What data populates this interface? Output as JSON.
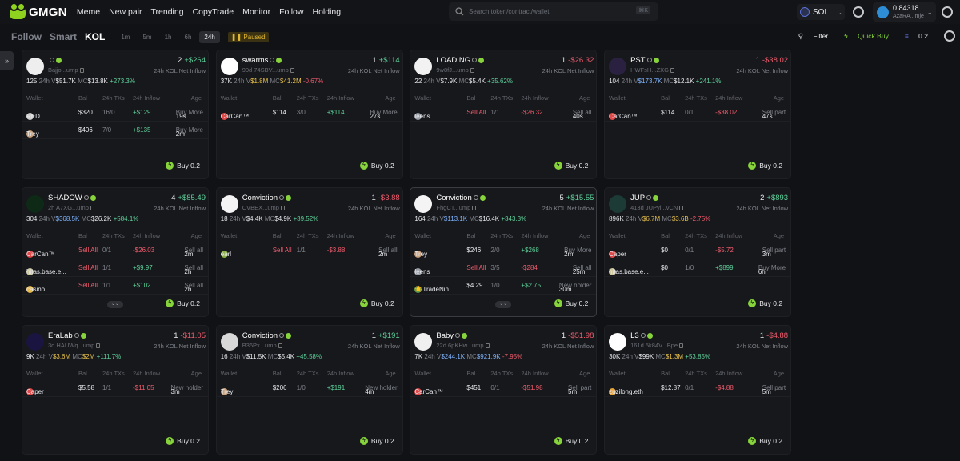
{
  "topbar": {
    "brand": "GMGN",
    "nav": [
      "Meme",
      "New pair",
      "Trending",
      "CopyTrade",
      "Monitor",
      "Follow",
      "Holding"
    ],
    "search_placeholder": "Search token/contract/wallet",
    "search_kbd": "⌘K",
    "chain": "SOL",
    "balance": "0.84318",
    "account": "AzaRA...mje"
  },
  "subbar": {
    "tabs": [
      "Follow",
      "Smart",
      "KOL"
    ],
    "timeframes": [
      "1m",
      "5m",
      "1h",
      "6h",
      "24h"
    ],
    "paused": "Paused",
    "filter": "Filter",
    "quick_buy": "Quick Buy",
    "quick_amount": "0.2"
  },
  "cols": [
    "Wallet",
    "Bal",
    "24h TXs",
    "24h Inflow",
    "Age"
  ],
  "buy_label": "Buy 0.2",
  "net_label": "24h KOL Net Inflow",
  "cards": [
    {
      "name": "",
      "addr": "Bajjo...ump",
      "kol": "2",
      "flow": "+$264",
      "holders": "125",
      "vol": "$51.7K",
      "mc": "$13.8K",
      "chg": "+273.3%",
      "chgc": "g",
      "volc": "w",
      "mcc": "w",
      "avatar": "#eeeeee",
      "rows": [
        {
          "w": "RED",
          "bal": "$320",
          "tx": "16/0",
          "in": "+$129",
          "age": "19s",
          "act": "Buy More",
          "txc": "gy",
          "ic": "#d0d0d0"
        },
        {
          "w": "Trey",
          "bal": "$406",
          "tx": "7/0",
          "in": "+$135",
          "age": "2m",
          "act": "Buy More",
          "txc": "gy",
          "ic": "#c9a27e"
        }
      ]
    },
    {
      "name": "swarms",
      "addr": "90d 74SBV...ump",
      "kol": "1",
      "flow": "+$114",
      "holders": "37K",
      "vol": "$1.8M",
      "mc": "$41.2M",
      "chg": "-0.67%",
      "chgc": "r",
      "volc": "yel",
      "mcc": "yel",
      "avatar": "#ffffff",
      "rows": [
        {
          "w": "CarCan™",
          "bal": "$114",
          "tx": "3/0",
          "in": "+$114",
          "age": "27s",
          "act": "Buy More",
          "txc": "gy",
          "ic": "#e04a4a"
        }
      ]
    },
    {
      "name": "LOADING",
      "addr": "9w8fJ...ump",
      "kol": "1",
      "flow": "-$26.32",
      "holders": "22",
      "vol": "$7.9K",
      "mc": "$5.4K",
      "chg": "+35.62%",
      "chgc": "g",
      "volc": "w",
      "mcc": "w",
      "avatar": "#f2f2f2",
      "rows": [
        {
          "w": "leens",
          "bal": "Sell All",
          "tx": "1/1",
          "in": "-$26.32",
          "age": "40s",
          "act": "Sell all",
          "txc": "gy",
          "ic": "#9aa0a8",
          "balc": "r"
        }
      ]
    },
    {
      "name": "PST",
      "addr": "HWFsH...ZXG",
      "kol": "1",
      "flow": "-$38.02",
      "holders": "104",
      "vol": "$173.7K",
      "mc": "$12.1K",
      "chg": "+241.1%",
      "chgc": "g",
      "volc": "bl",
      "mcc": "w",
      "avatar": "#2a2140",
      "rows": [
        {
          "w": "CarCan™",
          "bal": "$114",
          "tx": "0/1",
          "in": "-$38.02",
          "age": "47s",
          "act": "Sell part",
          "txc": "gy",
          "ic": "#e04a4a"
        }
      ]
    },
    {
      "name": "SHADOW",
      "addr": "2h A7XG...ump",
      "kol": "4",
      "flow": "+$85.49",
      "holders": "304",
      "vol": "$368.5K",
      "mc": "$26.2K",
      "chg": "+584.1%",
      "chgc": "g",
      "volc": "bl",
      "mcc": "w",
      "avatar": "#0e2a17",
      "exp": true,
      "rows": [
        {
          "w": "CarCan™",
          "bal": "Sell All",
          "tx": "0/1",
          "in": "-$26.03",
          "age": "2m",
          "act": "Sell all",
          "txc": "gy",
          "ic": "#e04a4a",
          "balc": "r"
        },
        {
          "w": "hitas.base.e...",
          "bal": "Sell All",
          "tx": "1/1",
          "in": "+$9.97",
          "age": "2h",
          "act": "Sell all",
          "txc": "gy",
          "ic": "#cfc7a0",
          "balc": "r"
        },
        {
          "w": "casino",
          "bal": "Sell All",
          "tx": "1/1",
          "in": "+$102",
          "age": "2h",
          "act": "Sell all",
          "txc": "gy",
          "ic": "#e7b84a",
          "balc": "r"
        }
      ]
    },
    {
      "name": "Conviction",
      "addr": "CVBEX...ump",
      "kol": "1",
      "flow": "-$3.88",
      "holders": "18",
      "vol": "$4.4K",
      "mc": "$4.9K",
      "chg": "+39.52%",
      "chgc": "g",
      "volc": "w",
      "mcc": "w",
      "avatar": "#f4f4f4",
      "rows": [
        {
          "w": "earl",
          "bal": "Sell All",
          "tx": "1/1",
          "in": "-$3.88",
          "age": "2m",
          "act": "Sell all",
          "txc": "gy",
          "ic": "#8ab04a",
          "balc": "r"
        }
      ]
    },
    {
      "name": "Conviction",
      "addr": "FhgCT...ump",
      "kol": "5",
      "flow": "+$15.55",
      "holders": "164",
      "vol": "$113.1K",
      "mc": "$16.4K",
      "chg": "+343.3%",
      "chgc": "g",
      "volc": "bl",
      "mcc": "w",
      "avatar": "#f4f4f4",
      "exp": true,
      "hl": true,
      "rows": [
        {
          "w": "Trey",
          "bal": "$246",
          "tx": "2/0",
          "in": "+$268",
          "age": "2m",
          "act": "Buy More",
          "txc": "gy",
          "ic": "#c9a27e"
        },
        {
          "w": "leens",
          "bal": "Sell All",
          "tx": "3/5",
          "in": "-$284",
          "age": "25m",
          "act": "Sell all",
          "txc": "gy",
          "ic": "#9aa0a8",
          "balc": "r"
        },
        {
          "w": "☀️TradeNin...",
          "bal": "$4.29",
          "tx": "1/0",
          "in": "+$2.75",
          "age": "30m",
          "act": "New holder",
          "txc": "gy",
          "ic": "#5a9a4a"
        }
      ]
    },
    {
      "name": "JUP",
      "addr": "413d JUPyi...vCN",
      "kol": "2",
      "flow": "+$893",
      "holders": "896K",
      "vol": "$6.7M",
      "mc": "$3.6B",
      "chg": "-2.75%",
      "chgc": "r",
      "volc": "yel",
      "mcc": "yel",
      "avatar": "#1c3a36",
      "rows": [
        {
          "w": "Caper",
          "bal": "$0",
          "tx": "0/1",
          "in": "-$5.72",
          "age": "3m",
          "act": "Sell part",
          "txc": "gy",
          "ic": "#e04a4a"
        },
        {
          "w": "hitas.base.e...",
          "bal": "$0",
          "tx": "1/0",
          "in": "+$899",
          "age": "6h",
          "act": "Buy More",
          "txc": "gy",
          "ic": "#cfc7a0"
        }
      ]
    },
    {
      "name": "EraLab",
      "addr": "3d HAUWq...ump",
      "kol": "1",
      "flow": "-$11.05",
      "holders": "9K",
      "vol": "$3.6M",
      "mc": "$2M",
      "chg": "+111.7%",
      "chgc": "g",
      "volc": "yel",
      "mcc": "yel",
      "avatar": "#1a1440",
      "rows": [
        {
          "w": "Caper",
          "bal": "$5.58",
          "tx": "1/1",
          "in": "-$11.05",
          "age": "3m",
          "act": "New holder",
          "txc": "gy",
          "ic": "#e04a4a"
        }
      ]
    },
    {
      "name": "Conviction",
      "addr": "B36Px...ump",
      "kol": "1",
      "flow": "+$191",
      "holders": "16",
      "vol": "$11.5K",
      "mc": "$5.4K",
      "chg": "+45.58%",
      "chgc": "g",
      "volc": "w",
      "mcc": "w",
      "avatar": "#d8d8d8",
      "rows": [
        {
          "w": "Trey",
          "bal": "$206",
          "tx": "1/0",
          "in": "+$191",
          "age": "4m",
          "act": "New holder",
          "txc": "gy",
          "ic": "#c9a27e"
        }
      ]
    },
    {
      "name": "Baby",
      "addr": "22d 6pKHw...ump",
      "kol": "1",
      "flow": "-$51.98",
      "holders": "7K",
      "vol": "$244.1K",
      "mc": "$921.9K",
      "chg": "-7.95%",
      "chgc": "r",
      "volc": "bl",
      "mcc": "bl",
      "avatar": "#f0f0f0",
      "rows": [
        {
          "w": "CarCan™",
          "bal": "$451",
          "tx": "0/1",
          "in": "-$51.98",
          "age": "5m",
          "act": "Sell part",
          "txc": "gy",
          "ic": "#e04a4a"
        }
      ]
    },
    {
      "name": "L3",
      "addr": "161d 5k84V...Bpe",
      "kol": "1",
      "flow": "-$4.88",
      "holders": "30K",
      "vol": "$99K",
      "mc": "$1.3M",
      "chg": "+53.85%",
      "chgc": "g",
      "volc": "w",
      "mcc": "yel",
      "avatar": "#ffffff",
      "rows": [
        {
          "w": "zuzilong.eth",
          "bal": "$12.87",
          "tx": "0/1",
          "in": "-$4.88",
          "age": "5m",
          "act": "Sell part",
          "txc": "gy",
          "ic": "#e7a43a"
        }
      ]
    }
  ]
}
